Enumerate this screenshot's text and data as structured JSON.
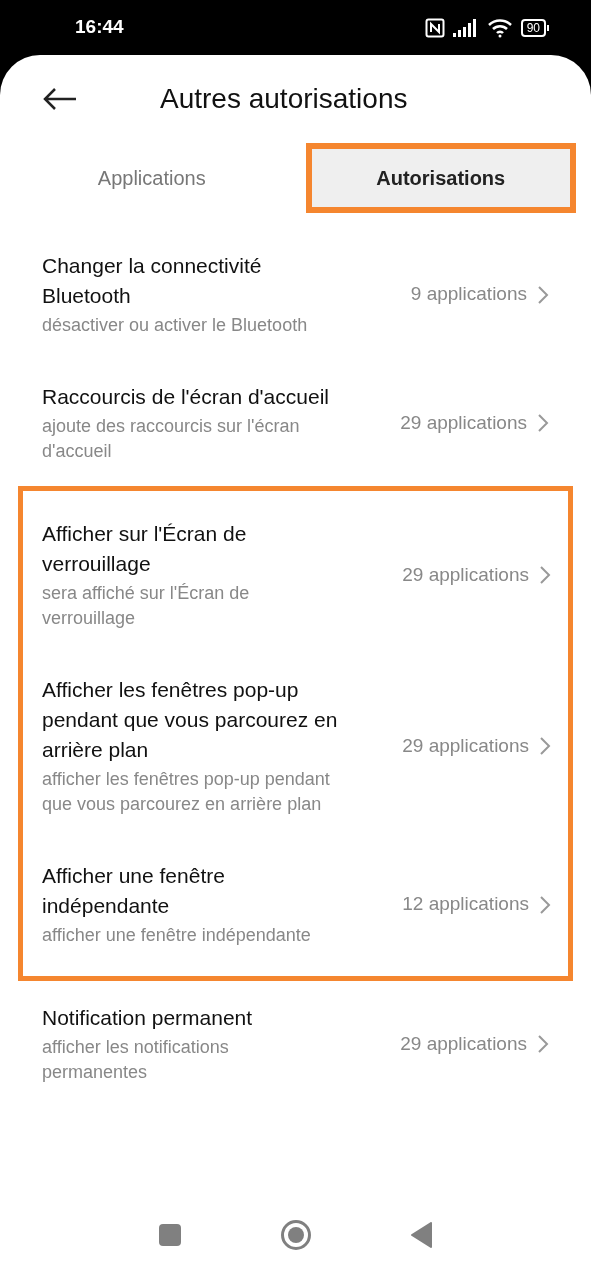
{
  "status_bar": {
    "time": "16:44",
    "battery": "90"
  },
  "header": {
    "title": "Autres autorisations"
  },
  "tabs": [
    {
      "label": "Applications",
      "selected": false,
      "highlighted": false
    },
    {
      "label": "Autorisations",
      "selected": true,
      "highlighted": true
    }
  ],
  "groups": [
    {
      "highlighted": false,
      "items": [
        {
          "title": "Changer la connectivité Bluetooth",
          "subtitle": "désactiver ou activer le Bluetooth",
          "count": "9 applications"
        },
        {
          "title": "Raccourcis de l'écran d'accueil",
          "subtitle": "ajoute des raccourcis sur l'écran d'accueil",
          "count": "29 applications"
        }
      ]
    },
    {
      "highlighted": true,
      "items": [
        {
          "title": "Afficher sur l'Écran de verrouillage",
          "subtitle": "sera affiché sur l'Écran de verrouillage",
          "count": "29 applications"
        },
        {
          "title": "Afficher les fenêtres pop-up pendant que vous parcourez en arrière plan",
          "subtitle": "afficher les fenêtres pop-up pendant que vous parcourez en arrière plan",
          "count": "29 applications"
        },
        {
          "title": "Afficher une fenêtre indépendante",
          "subtitle": "afficher une fenêtre indépendante",
          "count": "12 applications"
        }
      ]
    },
    {
      "highlighted": false,
      "items": [
        {
          "title": "Notification permanent",
          "subtitle": "afficher les notifications permanentes",
          "count": "29 applications"
        }
      ]
    }
  ]
}
